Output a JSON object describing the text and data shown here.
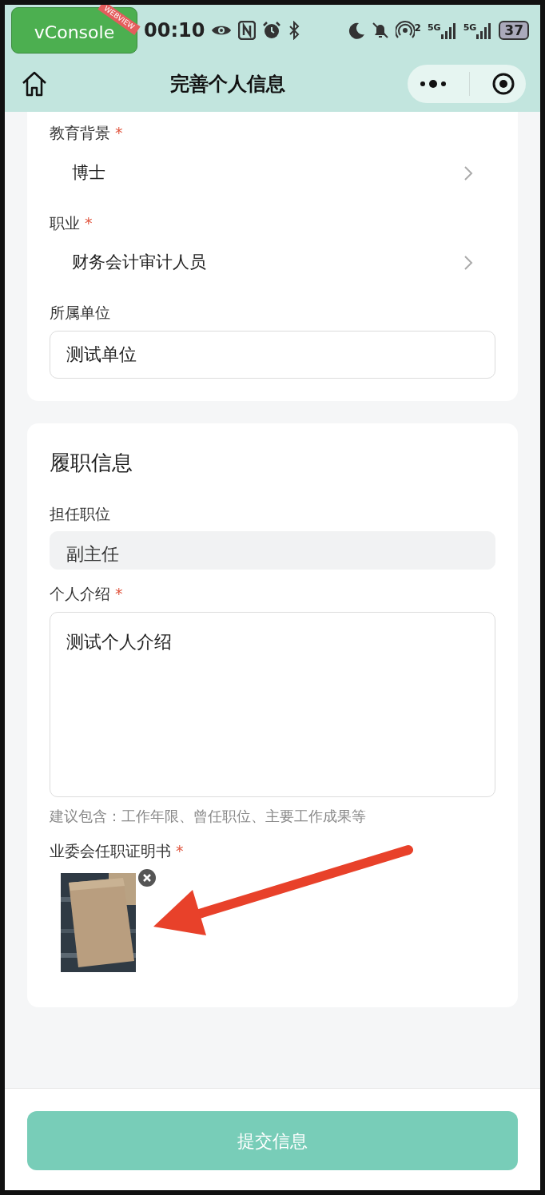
{
  "debug_badge": {
    "label": "vConsole",
    "ribbon": "WEBVIEW"
  },
  "status_bar": {
    "time": "00:10",
    "hotspot_count": "2",
    "network_labels": [
      "5G",
      "5G"
    ],
    "battery": "37"
  },
  "nav_bar": {
    "title": "完善个人信息"
  },
  "required_mark": "*",
  "sections": [
    {
      "fields": [
        {
          "kind": "picker",
          "label": "教育背景",
          "required": true,
          "value": "博士"
        },
        {
          "kind": "picker",
          "label": "职业",
          "required": true,
          "value": "财务会计审计人员"
        },
        {
          "kind": "input",
          "label": "所属单位",
          "required": false,
          "disabled": false,
          "value": "测试单位"
        }
      ]
    },
    {
      "title": "履职信息",
      "fields": [
        {
          "kind": "input",
          "label": "担任职位",
          "required": false,
          "disabled": true,
          "value": "副主任"
        },
        {
          "kind": "textarea",
          "label": "个人介绍",
          "required": true,
          "value": "测试个人介绍",
          "hint": "建议包含：工作年限、曾任职位、主要工作成果等"
        },
        {
          "kind": "upload",
          "label": "业委会任职证明书",
          "required": true
        }
      ]
    }
  ],
  "submit_button": {
    "label": "提交信息"
  }
}
